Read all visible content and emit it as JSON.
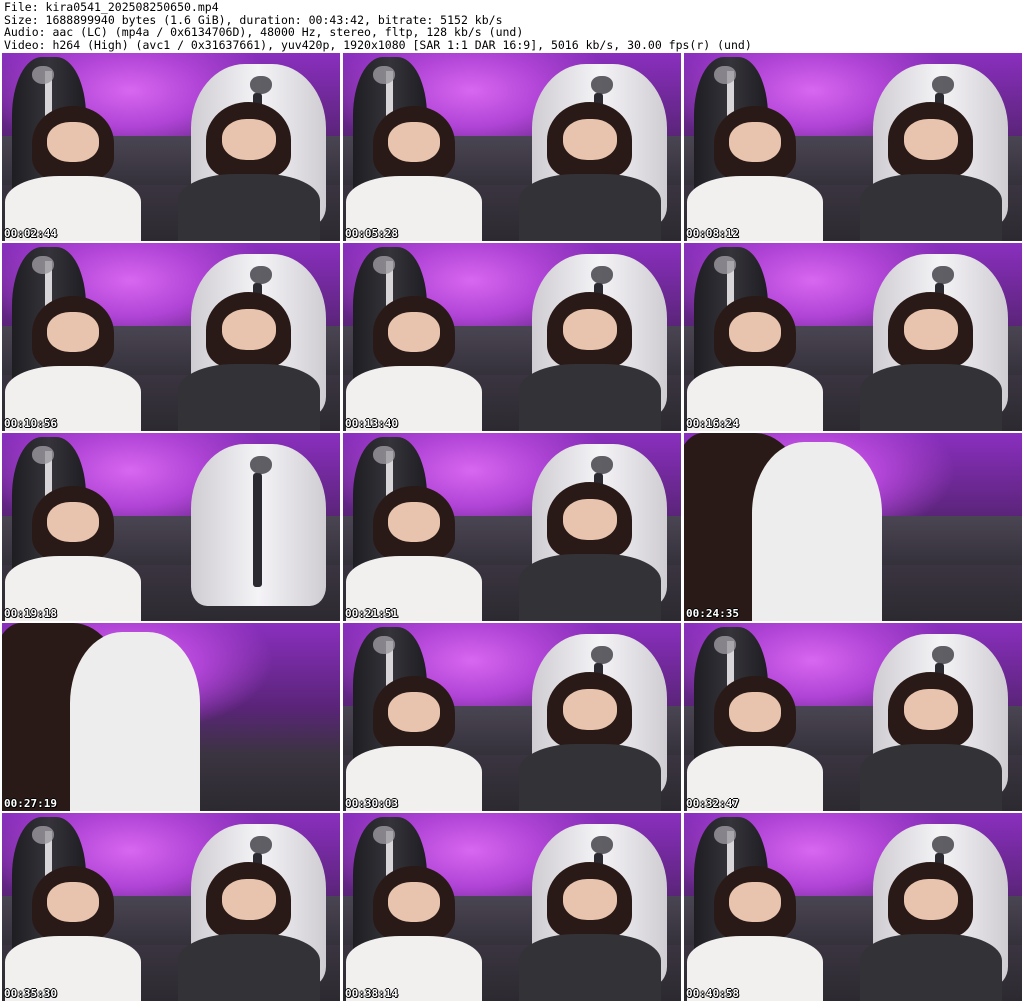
{
  "header": {
    "line1": "File: kira0541_202508250650.mp4",
    "line2": "Size: 1688899940 bytes (1.6 GiB), duration: 00:43:42, bitrate: 5152 kb/s",
    "line3": "Audio: aac (LC) (mp4a / 0x6134706D), 48000 Hz, stereo, fltp, 128 kb/s (und)",
    "line4": "Video: h264 (High) (avc1 / 0x31637661), yuv420p, 1920x1080 [SAR 1:1 DAR 16:9], 5016 kb/s, 30.00 fps(r) (und)"
  },
  "thumbnails": [
    {
      "timestamp": "00:02:44"
    },
    {
      "timestamp": "00:05:28"
    },
    {
      "timestamp": "00:08:12"
    },
    {
      "timestamp": "00:10:56"
    },
    {
      "timestamp": "00:13:40"
    },
    {
      "timestamp": "00:16:24"
    },
    {
      "timestamp": "00:19:18"
    },
    {
      "timestamp": "00:21:51"
    },
    {
      "timestamp": "00:24:35"
    },
    {
      "timestamp": "00:27:19"
    },
    {
      "timestamp": "00:30:03"
    },
    {
      "timestamp": "00:32:47"
    },
    {
      "timestamp": "00:35:30"
    },
    {
      "timestamp": "00:38:14"
    },
    {
      "timestamp": "00:40:58"
    }
  ],
  "colors": {
    "background": "#ffffff",
    "header_text": "#000000",
    "timestamp_text": "#ffffff",
    "timestamp_outline": "#000000",
    "scene_lighting": "#b044d6"
  }
}
